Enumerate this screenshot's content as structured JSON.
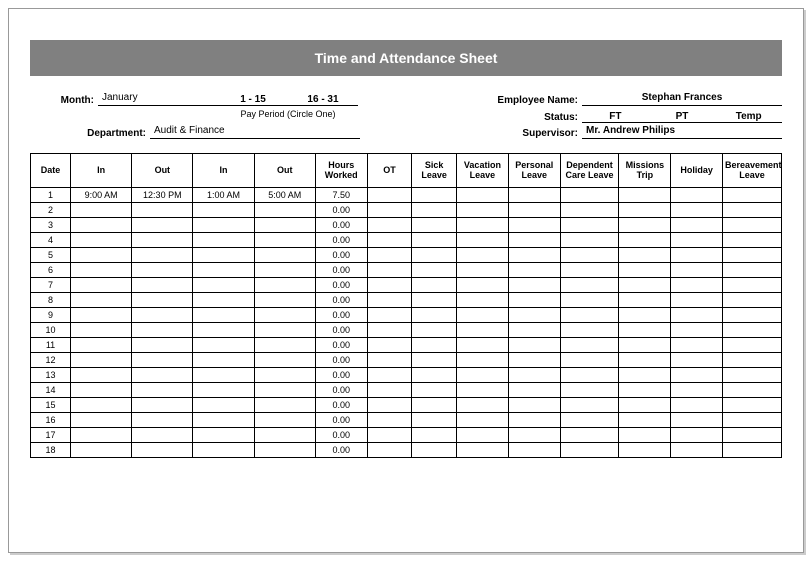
{
  "title": "Time and Attendance Sheet",
  "labels": {
    "month": "Month:",
    "pay_period_caption": "Pay Period (Circle One)",
    "department": "Department:",
    "employee": "Employee Name:",
    "status": "Status:",
    "supervisor": "Supervisor:"
  },
  "form": {
    "month": "January",
    "period1": "1 - 15",
    "period2": "16 - 31",
    "department": "Audit & Finance",
    "employee_name": "Stephan Frances",
    "status_ft": "FT",
    "status_pt": "PT",
    "status_temp": "Temp",
    "supervisor": "Mr. Andrew Philips"
  },
  "columns": {
    "date": "Date",
    "in1": "In",
    "out1": "Out",
    "in2": "In",
    "out2": "Out",
    "hours": "Hours Worked",
    "ot": "OT",
    "sick": "Sick Leave",
    "vacation": "Vacation Leave",
    "personal": "Personal Leave",
    "dependent": "Dependent Care Leave",
    "missions": "Missions Trip",
    "holiday": "Holiday",
    "bereave": "Bereavement Leave"
  },
  "rows": [
    {
      "date": "1",
      "in1": "9:00 AM",
      "out1": "12:30 PM",
      "in2": "1:00 AM",
      "out2": "5:00 AM",
      "hours": "7.50"
    },
    {
      "date": "2",
      "in1": "",
      "out1": "",
      "in2": "",
      "out2": "",
      "hours": "0.00"
    },
    {
      "date": "3",
      "in1": "",
      "out1": "",
      "in2": "",
      "out2": "",
      "hours": "0.00"
    },
    {
      "date": "4",
      "in1": "",
      "out1": "",
      "in2": "",
      "out2": "",
      "hours": "0.00"
    },
    {
      "date": "5",
      "in1": "",
      "out1": "",
      "in2": "",
      "out2": "",
      "hours": "0.00"
    },
    {
      "date": "6",
      "in1": "",
      "out1": "",
      "in2": "",
      "out2": "",
      "hours": "0.00"
    },
    {
      "date": "7",
      "in1": "",
      "out1": "",
      "in2": "",
      "out2": "",
      "hours": "0.00"
    },
    {
      "date": "8",
      "in1": "",
      "out1": "",
      "in2": "",
      "out2": "",
      "hours": "0.00"
    },
    {
      "date": "9",
      "in1": "",
      "out1": "",
      "in2": "",
      "out2": "",
      "hours": "0.00"
    },
    {
      "date": "10",
      "in1": "",
      "out1": "",
      "in2": "",
      "out2": "",
      "hours": "0.00"
    },
    {
      "date": "11",
      "in1": "",
      "out1": "",
      "in2": "",
      "out2": "",
      "hours": "0.00"
    },
    {
      "date": "12",
      "in1": "",
      "out1": "",
      "in2": "",
      "out2": "",
      "hours": "0.00"
    },
    {
      "date": "13",
      "in1": "",
      "out1": "",
      "in2": "",
      "out2": "",
      "hours": "0.00"
    },
    {
      "date": "14",
      "in1": "",
      "out1": "",
      "in2": "",
      "out2": "",
      "hours": "0.00"
    },
    {
      "date": "15",
      "in1": "",
      "out1": "",
      "in2": "",
      "out2": "",
      "hours": "0.00"
    },
    {
      "date": "16",
      "in1": "",
      "out1": "",
      "in2": "",
      "out2": "",
      "hours": "0.00"
    },
    {
      "date": "17",
      "in1": "",
      "out1": "",
      "in2": "",
      "out2": "",
      "hours": "0.00"
    },
    {
      "date": "18",
      "in1": "",
      "out1": "",
      "in2": "",
      "out2": "",
      "hours": "0.00"
    }
  ]
}
